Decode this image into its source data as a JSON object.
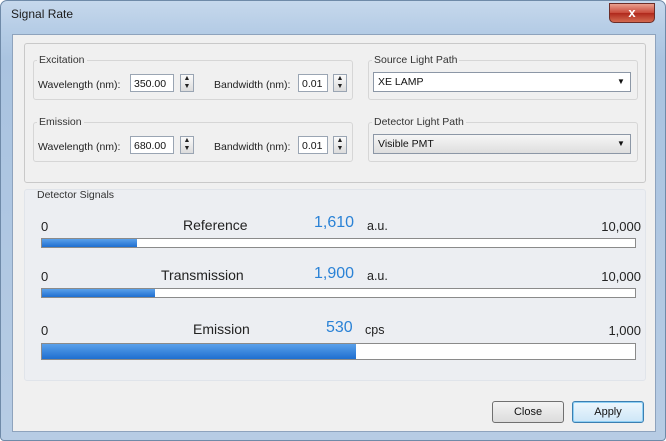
{
  "window": {
    "title": "Signal Rate",
    "close_glyph": "x"
  },
  "excitation": {
    "legend": "Excitation",
    "wavelength_label": "Wavelength (nm):",
    "wavelength_value": "350.00",
    "bandwidth_label": "Bandwidth (nm):",
    "bandwidth_value": "0.01"
  },
  "emission": {
    "legend": "Emission",
    "wavelength_label": "Wavelength (nm):",
    "wavelength_value": "680.00",
    "bandwidth_label": "Bandwidth (nm):",
    "bandwidth_value": "0.01"
  },
  "source_light_path": {
    "legend": "Source Light Path",
    "selected": "XE LAMP"
  },
  "detector_light_path": {
    "legend": "Detector Light Path",
    "selected": "Visible PMT"
  },
  "detector_signals": {
    "title": "Detector Signals",
    "rows": [
      {
        "name": "Reference",
        "min": "0",
        "value": "1,610",
        "unit": "a.u.",
        "max": "10,000",
        "fraction": 0.161
      },
      {
        "name": "Transmission",
        "min": "0",
        "value": "1,900",
        "unit": "a.u.",
        "max": "10,000",
        "fraction": 0.19
      },
      {
        "name": "Emission",
        "min": "0",
        "value": "530",
        "unit": "cps",
        "max": "1,000",
        "fraction": 0.53
      }
    ]
  },
  "buttons": {
    "close": "Close",
    "apply": "Apply"
  },
  "icons": {
    "spin_up": "▲",
    "spin_down": "▼",
    "dropdown": "▼"
  },
  "colors": {
    "value_text": "#2a82d6",
    "bar_fill": "#1f6fd0",
    "close_button": "#c8493a"
  }
}
